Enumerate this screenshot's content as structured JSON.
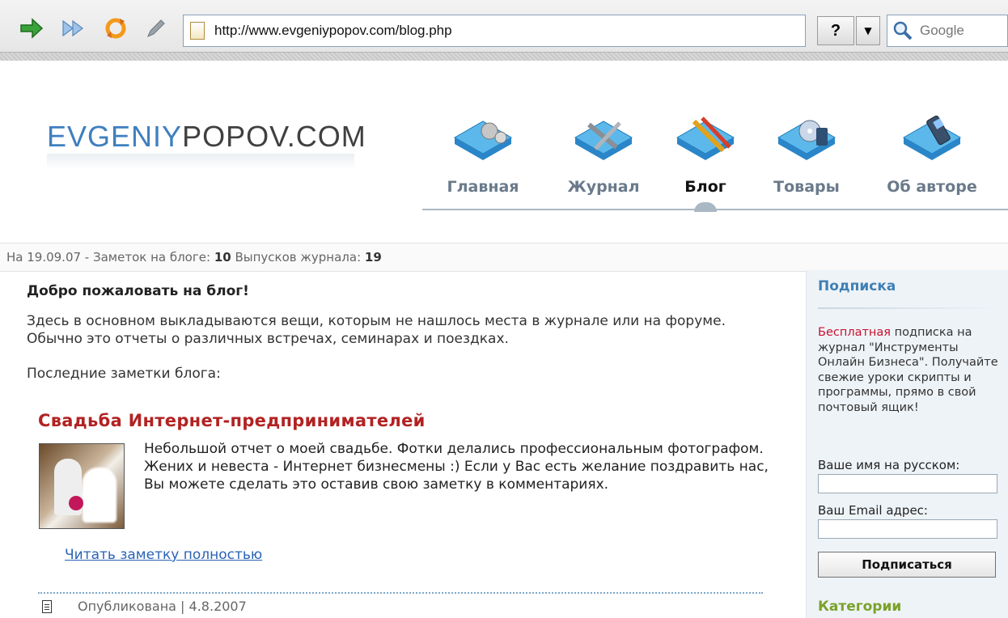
{
  "browser": {
    "url": "http://www.evgeniypopov.com/blog.php",
    "help_label": "?",
    "search_placeholder": "Google"
  },
  "site": {
    "logo_part1": "EVGENIY",
    "logo_part2": "POPOV.COM"
  },
  "nav": {
    "items": [
      {
        "label": "Главная",
        "icon": "gears-icon"
      },
      {
        "label": "Журнал",
        "icon": "tools-icon"
      },
      {
        "label": "Блог",
        "icon": "pencils-icon",
        "active": true
      },
      {
        "label": "Товары",
        "icon": "disc-icon"
      },
      {
        "label": "Об авторе",
        "icon": "phone-icon"
      }
    ]
  },
  "stats": {
    "prefix": "На 19.09.07 - Заметок на блоге:",
    "notes_count": "10",
    "issues_label": "Выпусков журнала:",
    "issues_count": "19"
  },
  "main": {
    "welcome": "Добро пожаловать на блог!",
    "intro": "Здесь в основном выкладываются вещи, которым не нашлось места в журнале или на форуме. Обычно это отчеты о различных встречах, семинарах и поездках.",
    "latest_label": "Последние заметки блога:",
    "post": {
      "title": "Свадьба Интернет-предпринимателей",
      "text": "Небольшой отчет о моей свадьбе. Фотки делались профессиональным фотографом. Жених и невеста - Интернет бизнесмены :) Если у Вас есть желание поздравить нас, Вы можете сделать это оставив свою заметку в комментариях.",
      "read_more": "Читать заметку полностью",
      "meta": "Опубликована | 4.8.2007"
    }
  },
  "sidebar": {
    "subscribe_heading": "Подписка",
    "free_word": "Бесплатная",
    "subscribe_text": " подписка на журнал \"Инструменты Онлайн Бизнеса\". Получайте свежие уроки скрипты и программы, прямо в свой почтовый ящик!",
    "name_label": "Ваше имя на русском:",
    "email_label": "Ваш Email адрес:",
    "subscribe_button": "Подписаться",
    "categories_heading": "Категории"
  },
  "colors": {
    "accent_blue": "#3f80b5",
    "post_title_red": "#b22222",
    "categories_green": "#7aa22a"
  }
}
